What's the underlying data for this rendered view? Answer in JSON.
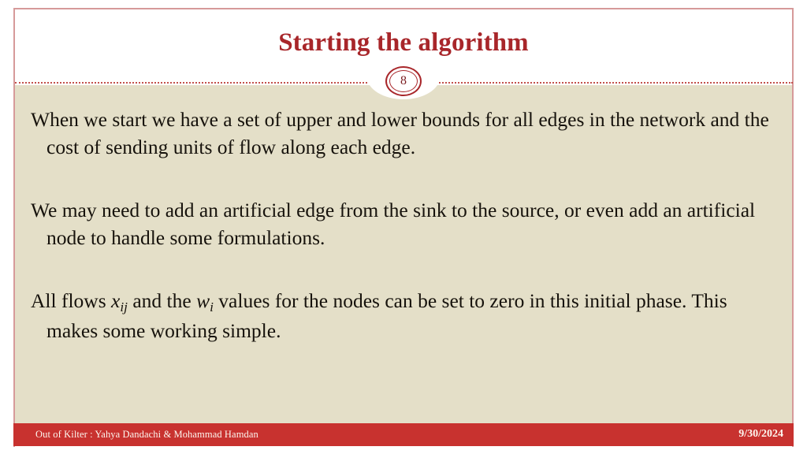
{
  "slide": {
    "title": "Starting the algorithm",
    "number": "8",
    "accent_color": "#a8262a",
    "footer_color": "#c8322f",
    "body_background": "#e4dfc8",
    "header_background": "#ffffff"
  },
  "content": {
    "paragraphs": [
      {
        "id": "paragraph-bounds",
        "segments": [
          {
            "type": "text",
            "value": "When we start we have a set of upper and lower bounds for all edges in the network and the cost of sending units of flow along each edge."
          }
        ]
      },
      {
        "id": "paragraph-artificial-edge",
        "segments": [
          {
            "type": "text",
            "value": "We may need to add an artificial edge from the sink to the source, or even add an artificial node to handle some formulations."
          }
        ]
      },
      {
        "id": "paragraph-initial-flows",
        "segments": [
          {
            "type": "text",
            "value": "All flows "
          },
          {
            "type": "math",
            "base": "x",
            "sub": "ij"
          },
          {
            "type": "text",
            "value": " and the "
          },
          {
            "type": "math",
            "base": "w",
            "sub": "i"
          },
          {
            "type": "text",
            "value": " values for the nodes can be set to zero in this initial phase. This makes some working simple."
          }
        ]
      }
    ]
  },
  "footer": {
    "left_text": "Out of Kilter : Yahya Dandachi & Mohammad Hamdan",
    "date": "9/30/2024"
  }
}
